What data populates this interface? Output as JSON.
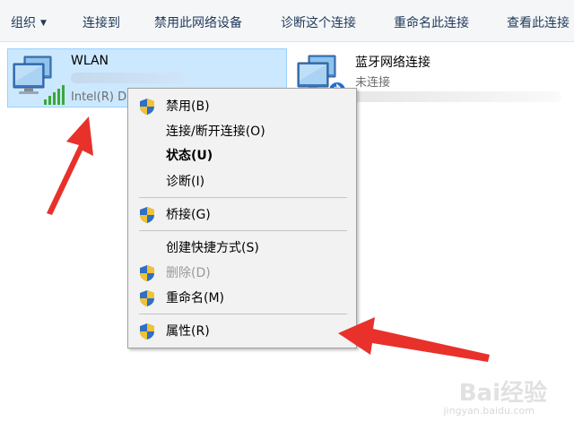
{
  "toolbar": {
    "organize": "组织",
    "connect_to": "连接到",
    "disable_device": "禁用此网络设备",
    "diagnose": "诊断这个连接",
    "rename": "重命名此连接",
    "view_status": "查看此连接"
  },
  "connections": [
    {
      "name": "WLAN",
      "status": "",
      "adapter": "Intel(R) D",
      "icon": "wifi-adapter-icon"
    },
    {
      "name": "蓝牙网络连接",
      "status": "未连接",
      "adapter": "",
      "icon": "bluetooth-adapter-icon"
    }
  ],
  "context_menu": {
    "items": [
      {
        "label": "禁用(B)",
        "shield": true,
        "disabled": false,
        "bold": false
      },
      {
        "label": "连接/断开连接(O)",
        "shield": false,
        "disabled": false,
        "bold": false
      },
      {
        "label": "状态(U)",
        "shield": false,
        "disabled": false,
        "bold": true
      },
      {
        "label": "诊断(I)",
        "shield": false,
        "disabled": false,
        "bold": false
      },
      {
        "label": "桥接(G)",
        "shield": true,
        "disabled": false,
        "bold": false
      },
      {
        "label": "创建快捷方式(S)",
        "shield": false,
        "disabled": false,
        "bold": false
      },
      {
        "label": "删除(D)",
        "shield": true,
        "disabled": true,
        "bold": false
      },
      {
        "label": "重命名(M)",
        "shield": true,
        "disabled": false,
        "bold": false
      },
      {
        "label": "属性(R)",
        "shield": true,
        "disabled": false,
        "bold": false
      }
    ]
  },
  "watermark": {
    "brand": "Bai经验",
    "url": "jingyan.baidu.com"
  },
  "colors": {
    "selected_bg": "#cce8ff",
    "selected_border": "#99d1ff",
    "arrow_red": "#e8312a",
    "shield_blue": "#2f6fc4",
    "shield_yellow": "#f2c232"
  }
}
